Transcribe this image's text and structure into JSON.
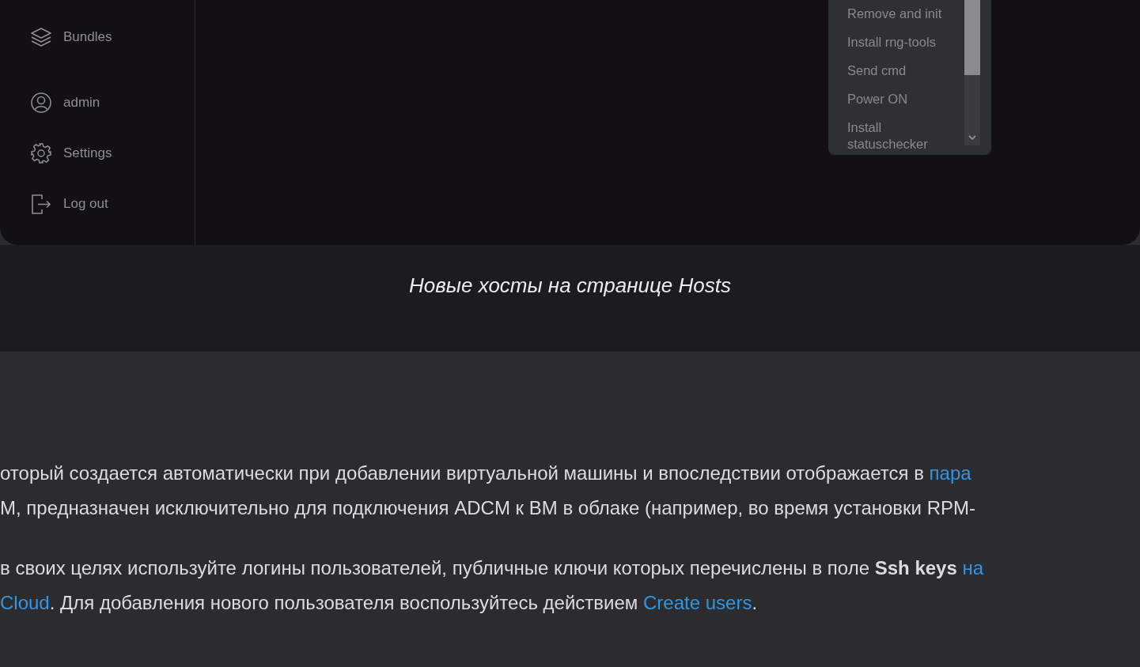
{
  "sidebar": {
    "items": [
      {
        "kind": "bundles",
        "label": "Bundles"
      },
      {
        "kind": "user",
        "label": "admin"
      },
      {
        "kind": "settings",
        "label": "Settings"
      },
      {
        "kind": "logout",
        "label": "Log out"
      }
    ]
  },
  "action_menu": {
    "items": [
      "Remove and init",
      "Install rng-tools",
      "Send cmd",
      "Power ON",
      "Install statuschecker"
    ]
  },
  "caption": "Новые хосты на странице Hosts",
  "article": {
    "paragraphs": [
      [
        [
          {
            "kind": "text",
            "text": "оторый создается автоматически при добавлении виртуальной машины и впоследствии отображается в "
          },
          {
            "kind": "link",
            "text": "пара"
          }
        ],
        [
          {
            "kind": "text",
            "text": "М, предназначен исключительно для подключения ADCM к ВМ в облаке (например, во время установки RPM-"
          }
        ]
      ],
      [
        [
          {
            "kind": "text",
            "text": " в своих целях используйте логины пользователей, публичные ключи которых перечислены в поле **Ssh keys** "
          },
          {
            "kind": "link",
            "text": "на"
          }
        ],
        [
          {
            "kind": "link",
            "text": "Cloud"
          },
          {
            "kind": "text",
            "text": ". Для добавления нового пользователя воспользуйтесь действием "
          },
          {
            "kind": "link",
            "text": "Create users"
          },
          {
            "kind": "text",
            "text": "."
          }
        ]
      ]
    ]
  }
}
